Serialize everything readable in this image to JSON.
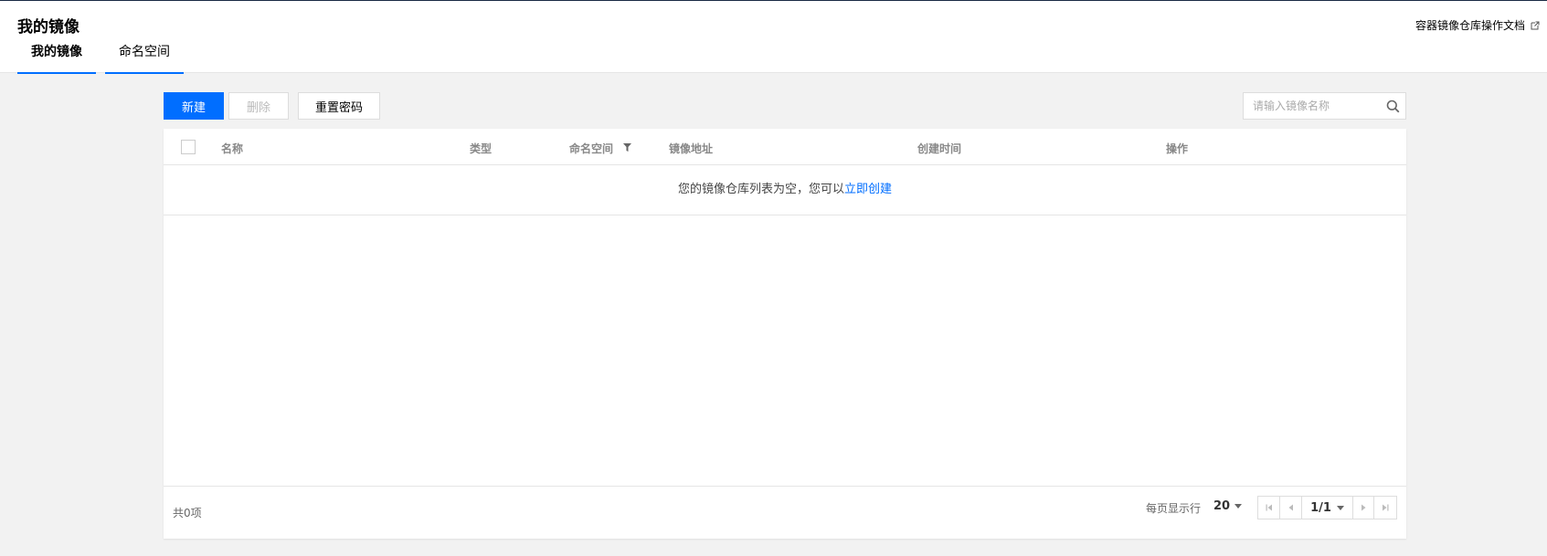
{
  "header": {
    "title": "我的镜像",
    "doc_link": "容器镜像仓库操作文档"
  },
  "tabs": [
    {
      "label": "我的镜像",
      "active": true
    },
    {
      "label": "命名空间",
      "active": false
    }
  ],
  "toolbar": {
    "new_label": "新建",
    "delete_label": "删除",
    "reset_password_label": "重置密码"
  },
  "search": {
    "placeholder": "请输入镜像名称",
    "value": ""
  },
  "table": {
    "columns": [
      "名称",
      "类型",
      "命名空间",
      "镜像地址",
      "创建时间",
      "操作"
    ],
    "rows": [],
    "empty_text": "您的镜像仓库列表为空，您可以",
    "empty_link": "立即创建"
  },
  "footer": {
    "total": "共0项",
    "per_page_label": "每页显示行",
    "per_page_value": "20",
    "page_indicator": "1/1"
  },
  "colors": {
    "accent": "#006eff",
    "background": "#f2f2f2"
  },
  "icons": [
    "external-link-icon",
    "search-icon",
    "filter-icon",
    "caret-down-icon",
    "first-page-icon",
    "prev-page-icon",
    "next-page-icon",
    "last-page-icon"
  ]
}
